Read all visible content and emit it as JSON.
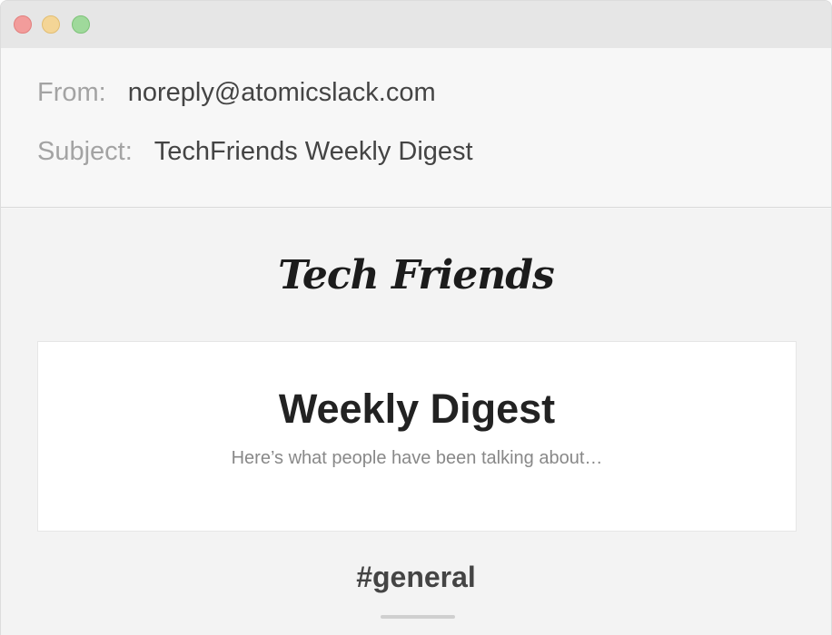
{
  "window": {
    "controls": [
      "close",
      "minimize",
      "zoom"
    ],
    "colors": {
      "close": "#f29c9b",
      "minimize": "#f4d596",
      "zoom": "#9fd99b"
    }
  },
  "email": {
    "from_label": "From:",
    "from_value": "noreply@atomicslack.com",
    "subject_label": "Subject:",
    "subject_value": "TechFriends Weekly Digest"
  },
  "body": {
    "logo_text": "Tech Friends",
    "card": {
      "title": "Weekly Digest",
      "subtitle": "Here’s what people have been talking about…"
    },
    "channel": "#general"
  }
}
